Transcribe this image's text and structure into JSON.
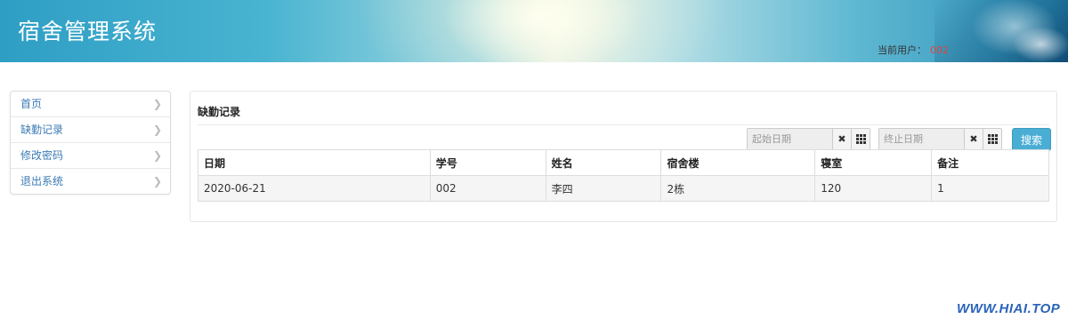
{
  "header": {
    "app_title": "宿舍管理系统",
    "current_user_label": "当前用户：",
    "current_user_value": "002"
  },
  "sidebar": {
    "items": [
      {
        "label": "首页"
      },
      {
        "label": "缺勤记录"
      },
      {
        "label": "修改密码"
      },
      {
        "label": "退出系统"
      }
    ]
  },
  "main": {
    "panel_title": "缺勤记录",
    "filters": {
      "start_date_placeholder": "起始日期",
      "end_date_placeholder": "终止日期",
      "search_label": "搜索"
    },
    "table": {
      "columns": [
        "日期",
        "学号",
        "姓名",
        "宿舍楼",
        "寝室",
        "备注"
      ],
      "rows": [
        [
          "2020-06-21",
          "002",
          "李四",
          "2栋",
          "120",
          "1"
        ]
      ]
    }
  },
  "watermark": "WWW.HIAI.TOP",
  "colors": {
    "link_blue": "#3b7bb5",
    "search_button": "#4aaed4",
    "user_value_red": "#e0453a"
  }
}
